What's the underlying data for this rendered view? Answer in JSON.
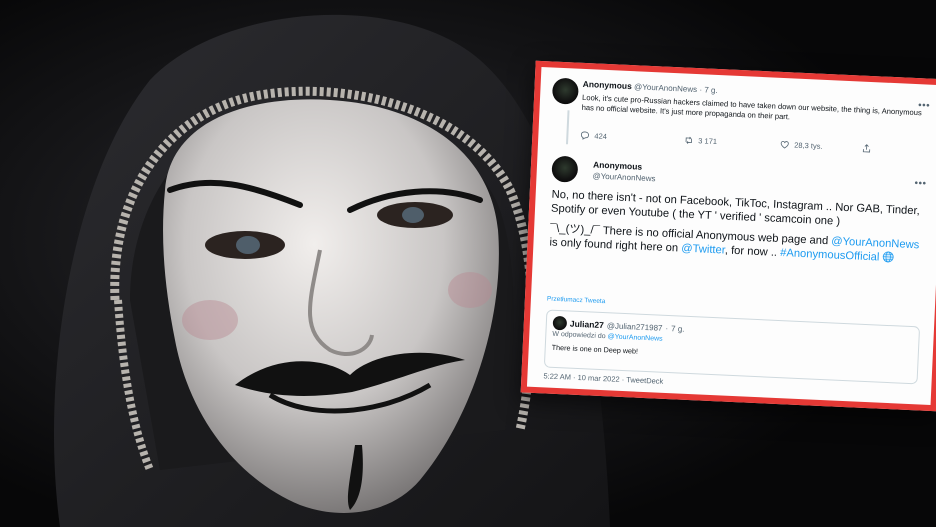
{
  "tweet1": {
    "name": "Anonymous",
    "handle": "@YourAnonNews",
    "time": "7 g.",
    "text": "Look, it's cute pro-Russian hackers claimed to have taken down our website, the thing is, Anonymous has no official website. It's just more propaganda on their part.",
    "replies": "424",
    "retweets": "3 171",
    "likes": "28,3 tys."
  },
  "tweet2": {
    "name": "Anonymous",
    "handle": "@YourAnonNews",
    "paragraph1": "No, no there isn't - not on Facebook, TikToc, Instagram ..  Nor GAB, Tinder, Spotify or even Youtube ( the YT ' verified ' scamcoin one )",
    "shrug": "¯\\_(ツ)_/¯",
    "p2_a": " There is no official Anonymous web page and ",
    "mention1": "@YourAnonNews",
    "p2_b": " is only found right here on ",
    "mention2": "@Twitter",
    "p2_c": ", for now .. ",
    "hashtag": "#AnonymousOfficial",
    "translate": "Przetłumacz Tweeta",
    "footer": "5:22 AM · 10 mar 2022 · TweetDeck"
  },
  "quote": {
    "name": "Julian27",
    "handle": "@Julian271987",
    "time": "7 g.",
    "reply_prefix": "W odpowiedzi do ",
    "reply_handle": "@YourAnonNews",
    "text": "There is one on Deep web!"
  },
  "icons": {
    "more": "more-icon",
    "reply": "reply-icon",
    "retweet": "retweet-icon",
    "like": "heart-icon",
    "share": "share-icon",
    "globe": "globe-icon"
  },
  "colors": {
    "frame": "#e53935",
    "link": "#1d9bf0",
    "muted": "#536471"
  }
}
